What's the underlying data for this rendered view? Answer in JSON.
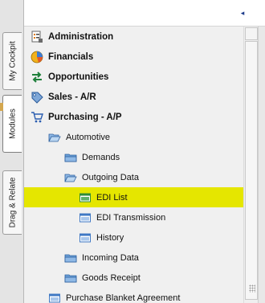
{
  "side_tabs": [
    {
      "label": "My Cockpit"
    },
    {
      "label": "Modules"
    },
    {
      "label": "Drag & Relate"
    }
  ],
  "header": {
    "collapse_glyph": "◂"
  },
  "tree": [
    {
      "label": "Administration",
      "icon": "administration-icon"
    },
    {
      "label": "Financials",
      "icon": "financials-icon"
    },
    {
      "label": "Opportunities",
      "icon": "opportunities-icon"
    },
    {
      "label": "Sales - A/R",
      "icon": "sales-icon"
    },
    {
      "label": "Purchasing - A/P",
      "icon": "purchasing-cart-icon"
    },
    {
      "label": "Automotive",
      "icon": "open-folder-icon"
    },
    {
      "label": "Demands",
      "icon": "folder-icon"
    },
    {
      "label": "Outgoing Data",
      "icon": "open-folder-icon"
    },
    {
      "label": "EDI List",
      "icon": "form-icon",
      "selected": true
    },
    {
      "label": "EDI Transmission",
      "icon": "form-icon"
    },
    {
      "label": "History",
      "icon": "form-icon"
    },
    {
      "label": "Incoming Data",
      "icon": "folder-icon"
    },
    {
      "label": "Goods Receipt",
      "icon": "folder-icon"
    },
    {
      "label": "Purchase Blanket Agreement",
      "icon": "form-icon"
    }
  ],
  "colors": {
    "selection": "#e5e600",
    "folder": "#6aa0d8",
    "form_window": "#3f78c4",
    "form_window_selected": "#2e8b3a",
    "cart": "#2a5db0"
  }
}
